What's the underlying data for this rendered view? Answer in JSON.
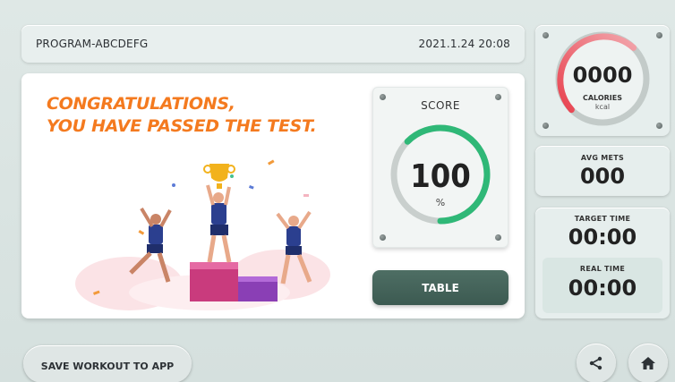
{
  "header": {
    "program": "PROGRAM-ABCDEFG",
    "datetime": "2021.1.24  20:08"
  },
  "result": {
    "line1": "CONGRATULATIONS,",
    "line2": "YOU HAVE PASSED THE TEST."
  },
  "score": {
    "label": "SCORE",
    "value": "100",
    "unit": "%",
    "percent": 100
  },
  "table_button": "TABLE",
  "calories": {
    "value": "0000",
    "label": "CALORIES",
    "unit": "kcal"
  },
  "avg_mets": {
    "label": "AVG METS",
    "value": "000"
  },
  "target_time": {
    "label": "TARGET TIME",
    "value": "00:00"
  },
  "real_time": {
    "label": "REAL TIME",
    "value": "00:00"
  },
  "footer": {
    "save_label": "SAVE WORKOUT TO APP",
    "share_icon": "share-icon",
    "home_icon": "home-icon"
  },
  "colors": {
    "accent_orange": "#f47a1f",
    "gauge_green": "#2fb877",
    "gauge_red": "#e8424f",
    "button_dark": "#3c5a51"
  }
}
